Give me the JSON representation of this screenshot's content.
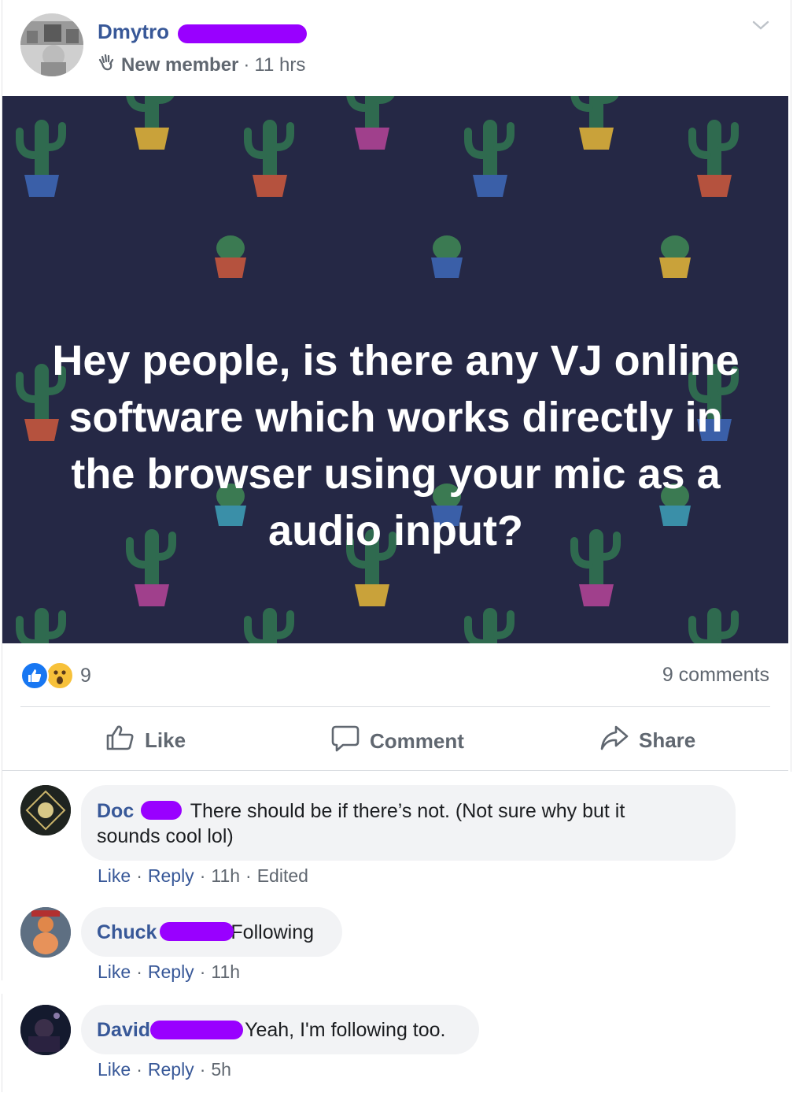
{
  "post": {
    "author_first": "Dmytro",
    "badge": "New member",
    "time": "11 hrs",
    "banner_text": "Hey people, is there any VJ online software which works directly in the browser using your mic as a audio input?",
    "reaction_count": "9",
    "comment_count": "9 comments",
    "actions": {
      "like": "Like",
      "comment": "Comment",
      "share": "Share"
    },
    "colors": {
      "banner_bg": "#252845",
      "link": "#385898",
      "redaction": "#9900ff"
    }
  },
  "comments": [
    {
      "name": "Doc",
      "text_line1": "There should be if there’s not. (Not sure why but it",
      "text_line2": "sounds cool lol)",
      "like": "Like",
      "reply": "Reply",
      "time": "11h",
      "edited": "Edited"
    },
    {
      "name": "Chuck",
      "text": "Following",
      "like": "Like",
      "reply": "Reply",
      "time": "11h"
    },
    {
      "name": "David",
      "text": "Yeah, I'm following too.",
      "like": "Like",
      "reply": "Reply",
      "time": "5h"
    }
  ]
}
